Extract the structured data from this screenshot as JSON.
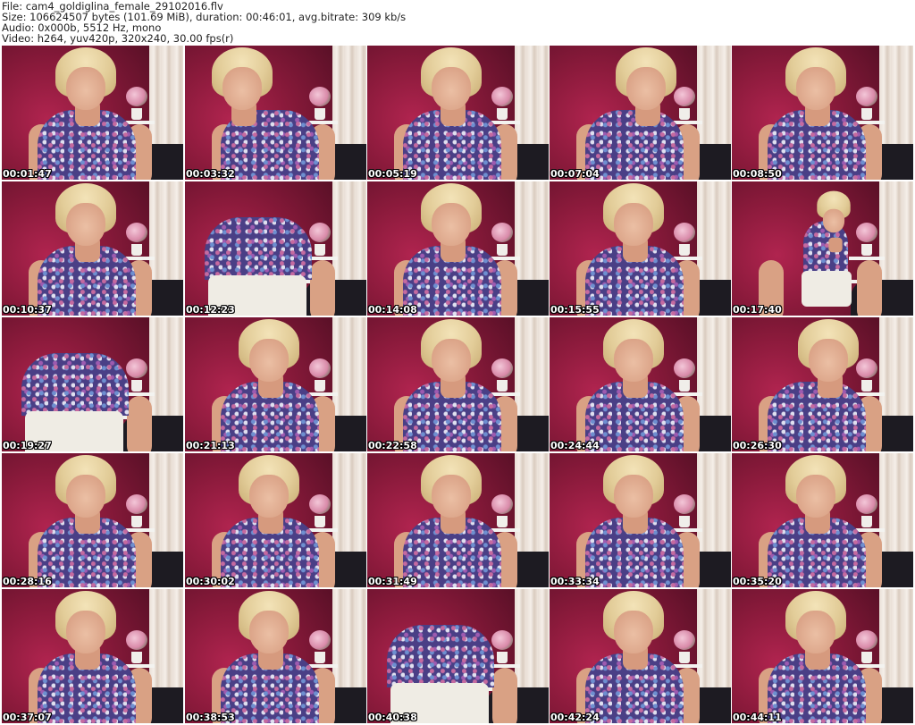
{
  "header": {
    "file_line": "File: cam4_goldiglina_female_29102016.flv",
    "size_line": "Size: 106624507 bytes (101.69 MiB), duration: 00:46:01, avg.bitrate: 309 kb/s",
    "audio_line": "Audio: 0x000b, 5512 Hz, mono",
    "video_line": "Video: h264, yuv420p, 320x240, 30.00 fps(r)"
  },
  "thumbnails": [
    {
      "timestamp": "00:01:47"
    },
    {
      "timestamp": "00:03:32"
    },
    {
      "timestamp": "00:05:19"
    },
    {
      "timestamp": "00:07:04"
    },
    {
      "timestamp": "00:08:50"
    },
    {
      "timestamp": "00:10:37"
    },
    {
      "timestamp": "00:12:23"
    },
    {
      "timestamp": "00:14:08"
    },
    {
      "timestamp": "00:15:55"
    },
    {
      "timestamp": "00:17:40"
    },
    {
      "timestamp": "00:19:27"
    },
    {
      "timestamp": "00:21:13"
    },
    {
      "timestamp": "00:22:58"
    },
    {
      "timestamp": "00:24:44"
    },
    {
      "timestamp": "00:26:30"
    },
    {
      "timestamp": "00:28:16"
    },
    {
      "timestamp": "00:30:02"
    },
    {
      "timestamp": "00:31:49"
    },
    {
      "timestamp": "00:33:34"
    },
    {
      "timestamp": "00:35:20"
    },
    {
      "timestamp": "00:37:07"
    },
    {
      "timestamp": "00:38:53"
    },
    {
      "timestamp": "00:40:38"
    },
    {
      "timestamp": "00:42:24"
    },
    {
      "timestamp": "00:44:11"
    }
  ]
}
